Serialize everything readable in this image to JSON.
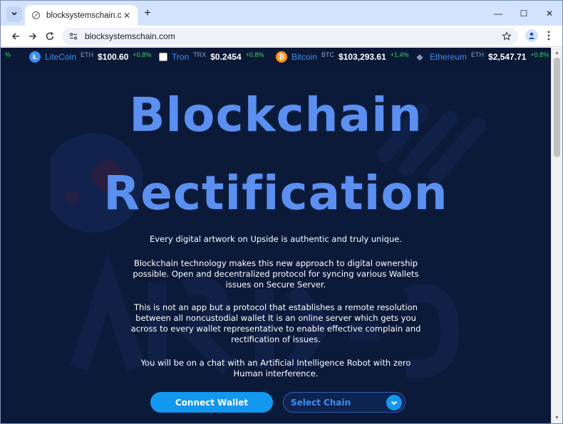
{
  "browser": {
    "tab_title": "blocksystemschain.com",
    "url": "blocksystemschain.com",
    "new_tab_symbol": "+",
    "close_symbol": "✕",
    "minimize_symbol": "—",
    "maximize_symbol": "☐",
    "window_close_symbol": "✕"
  },
  "ticker": {
    "partial_change": "%",
    "items": [
      {
        "name": "LiteCoin",
        "symbol": "ETH",
        "price": "$100.60",
        "change": "+0.8%",
        "color": "#3d8ff0",
        "icon": "litecoin-icon",
        "glyph": "Ł"
      },
      {
        "name": "Tron",
        "symbol": "TRX",
        "price": "$0.2454",
        "change": "+0.8%",
        "color": "#ffffff",
        "icon": "tron-icon",
        "glyph": ""
      },
      {
        "name": "Bitcoin",
        "symbol": "BTC",
        "price": "$103,293.61",
        "change": "+1.4%",
        "color": "#f7931a",
        "icon": "bitcoin-icon",
        "glyph": "₿"
      },
      {
        "name": "Ethereum",
        "symbol": "ETH",
        "price": "$2,547.71",
        "change": "+0.8%",
        "color": "#8a92b2",
        "icon": "ethereum-icon",
        "glyph": "◆"
      }
    ]
  },
  "hero": {
    "line1": "Blockchain",
    "line2": "Rectification"
  },
  "content": {
    "p1": "Every digital artwork on Upside is authentic and truly unique.",
    "p2": "Blockchain technology makes this new approach to digital ownership possible. Open and decentralized protocol for syncing various Wallets issues on Secure Server.",
    "p3": "This is not an app but a protocol that establishes a remote resolution between all noncustodial wallet It is an online server which gets you across to every wallet representative to enable effective complain and rectification of issues.",
    "p4": "You will be on a chat with an Artificial Intelligence Robot with zero Human interference."
  },
  "actions": {
    "connect_label": "Connect Wallet",
    "select_label": "Select Chain"
  },
  "colors": {
    "page_bg": "#0c1a3a",
    "accent": "#1497ee",
    "title": "#5b8ff0",
    "positive": "#3cd46a"
  }
}
